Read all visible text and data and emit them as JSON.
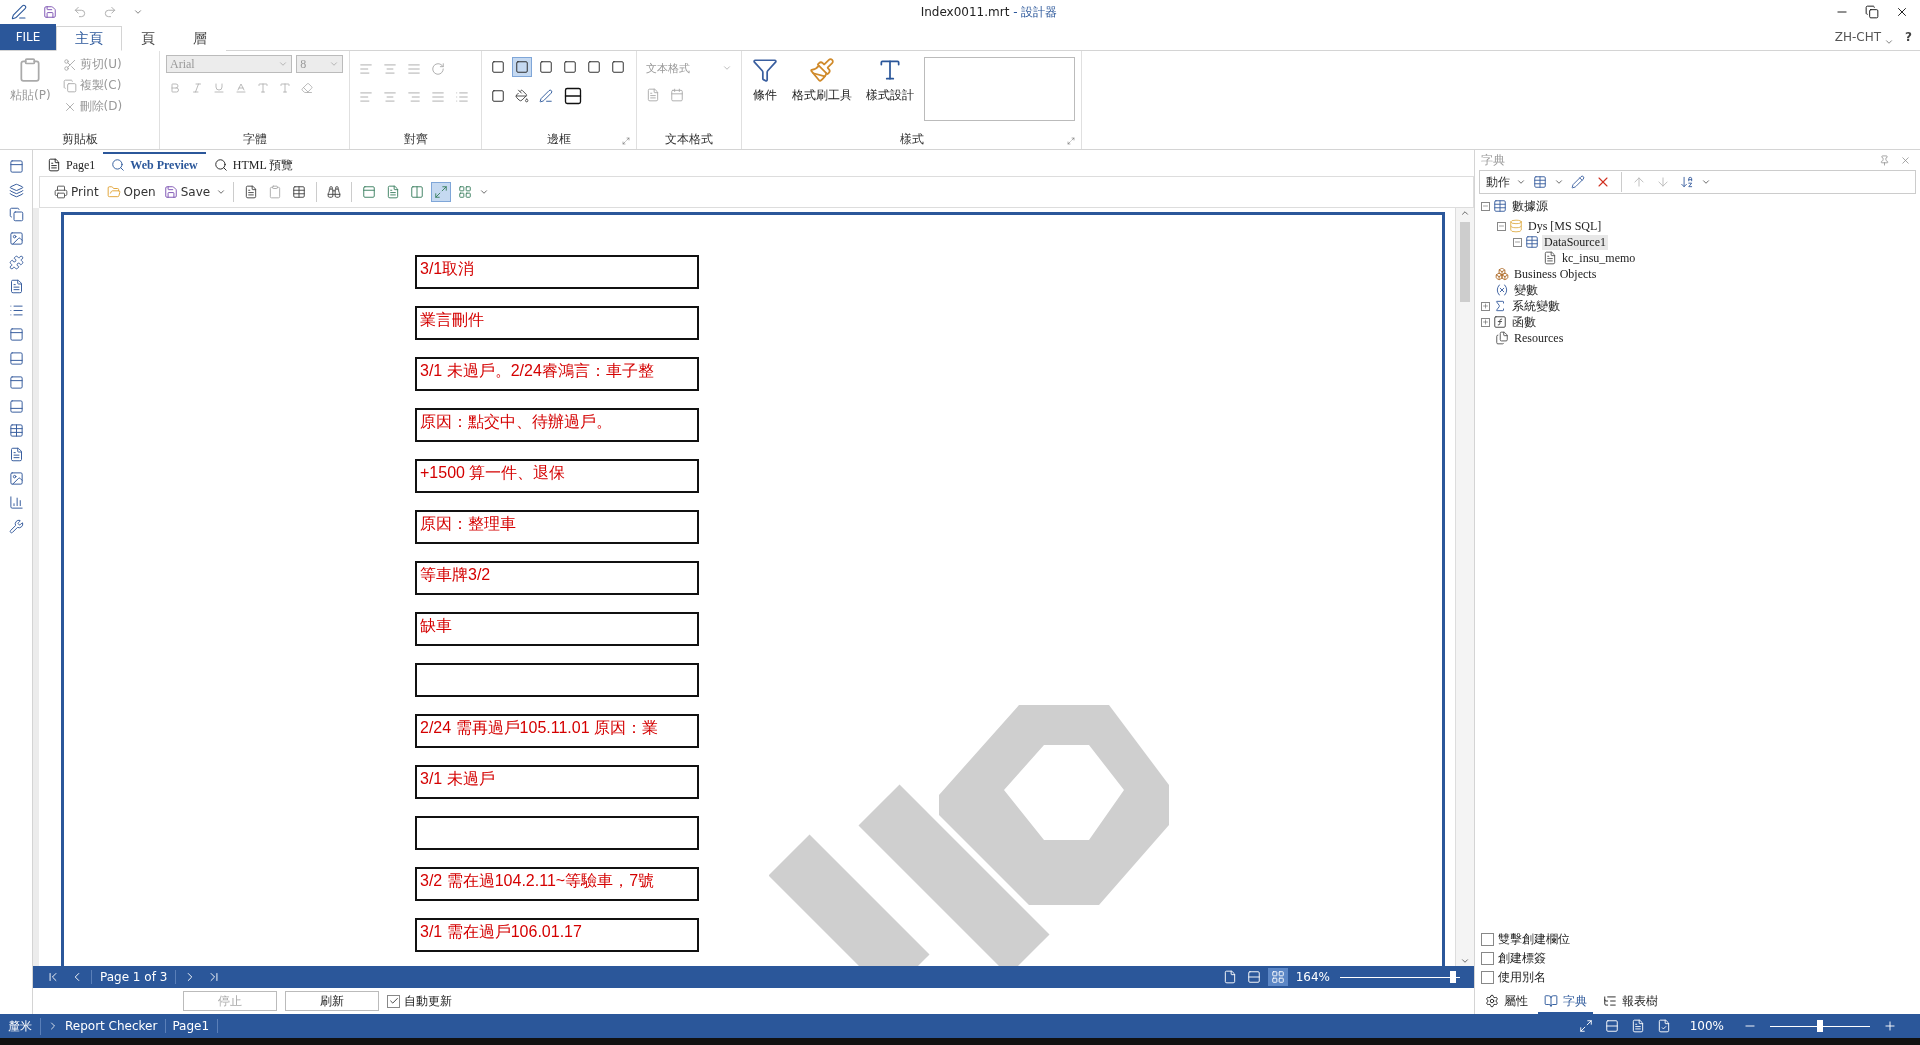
{
  "window": {
    "title": "Index0011.mrt",
    "subtitle": "- 設計器"
  },
  "ribbon_tabs": [
    {
      "label": "FILE",
      "kind": "file",
      "selected": false
    },
    {
      "label": "主頁",
      "kind": "tab",
      "selected": true
    },
    {
      "label": "頁",
      "kind": "tab",
      "selected": false
    },
    {
      "label": "層",
      "kind": "tab",
      "selected": false
    }
  ],
  "language": "ZH-CHT",
  "help": "?",
  "clipboard": {
    "title": "剪貼板",
    "paste": {
      "label": "粘貼(P)",
      "disabled": true
    },
    "items": [
      {
        "label": "剪切(U)",
        "disabled": true
      },
      {
        "label": "複製(C)",
        "disabled": true
      },
      {
        "label": "刪除(D)",
        "disabled": true
      }
    ]
  },
  "font": {
    "title": "字體",
    "font_name": "Arial",
    "font_size": "8",
    "disabled": true
  },
  "alignment": {
    "title": "對齊",
    "disabled": true
  },
  "borders": {
    "title": "邊框",
    "buttons": [
      {
        "selected": false
      },
      {
        "selected": true
      },
      {
        "selected": false
      },
      {
        "selected": false
      },
      {
        "selected": false
      },
      {
        "selected": false
      }
    ]
  },
  "text_format": {
    "title": "文本格式",
    "placeholder": "文本格式",
    "disabled": true
  },
  "styles": {
    "title": "樣式",
    "buttons": [
      {
        "label": "條件"
      },
      {
        "label": "格式刷工具"
      },
      {
        "label": "樣式設計"
      }
    ]
  },
  "designer_tabs": [
    {
      "label": "Page1",
      "selected": false
    },
    {
      "label": "Web Preview",
      "selected": true
    },
    {
      "label": "HTML 預覽",
      "selected": false
    }
  ],
  "preview_toolbar": {
    "buttons": [
      {
        "label": "Print"
      },
      {
        "label": "Open"
      },
      {
        "label": "Save"
      }
    ],
    "view_buttons": [
      {
        "selected": false
      },
      {
        "selected": false
      },
      {
        "selected": false
      },
      {
        "selected": true
      },
      {
        "selected": false
      }
    ]
  },
  "report_rows": [
    "3/1取消",
    "業言刪件",
    "3/1 未過戶。2/24睿鴻言：車子整",
    "原因：點交中、待辦過戶。",
    "+1500 算一件、退保",
    "原因：整理車",
    "等車牌3/2",
    "缺車",
    "",
    "2/24 需再過戶105.11.01 原因：業",
    "3/1 未過戶",
    "",
    "3/2 需在過104.2.11~等驗車，7號",
    "3/1 需在過戶106.01.17"
  ],
  "page_nav": {
    "label": "Page 1 of 3",
    "modes": [
      {
        "selected": false
      },
      {
        "selected": false
      },
      {
        "selected": true
      }
    ],
    "zoom": "164%",
    "level": 0.94
  },
  "refresh_bar": {
    "stop": {
      "label": "停止",
      "disabled": true
    },
    "refresh": {
      "label": "刷新",
      "disabled": false
    },
    "auto": {
      "label": "自動更新",
      "checked": true
    }
  },
  "dictionary": {
    "title": "字典",
    "action": "動作",
    "tree": [
      {
        "label": "數據源",
        "kind": "table",
        "expanded": true,
        "selected": false,
        "children": [
          {
            "label": "Dys [MS SQL]",
            "kind": "database",
            "expanded": true,
            "selected": false,
            "children": [
              {
                "label": "DataSource1",
                "kind": "table",
                "expanded": true,
                "selected": true,
                "children": [
                  {
                    "label": "kc_insu_memo",
                    "kind": "column",
                    "selected": false
                  }
                ]
              }
            ]
          }
        ]
      },
      {
        "label": "Business Objects",
        "kind": "business",
        "selected": false
      },
      {
        "label": "變數",
        "kind": "variable",
        "selected": false
      },
      {
        "label": "系統變數",
        "kind": "system",
        "expanded": false,
        "selected": false
      },
      {
        "label": "函數",
        "kind": "function",
        "expanded": false,
        "selected": false
      },
      {
        "label": "Resources",
        "kind": "resource",
        "selected": false
      }
    ]
  },
  "options": [
    {
      "label": "雙擊創建欄位",
      "checked": false
    },
    {
      "label": "創建標簽",
      "checked": false
    },
    {
      "label": "使用別名",
      "checked": false
    }
  ],
  "panel_tabs": [
    {
      "label": "屬性",
      "selected": false
    },
    {
      "label": "字典",
      "selected": true
    },
    {
      "label": "報表樹",
      "selected": false
    }
  ],
  "status_bar": {
    "unit": "釐米",
    "items": [
      "Report Checker",
      "Page1"
    ],
    "zoom": "100%",
    "level": 0.5
  }
}
